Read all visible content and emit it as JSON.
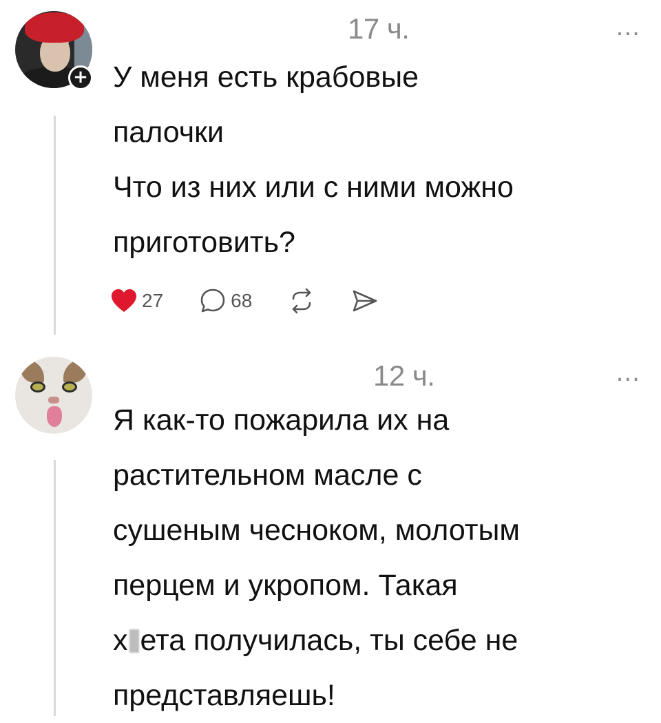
{
  "posts": [
    {
      "time": "17 ч.",
      "more": "...",
      "follow_badge": "+",
      "lines": [
        "У меня есть крабовые",
        "палочки",
        "Что из них или с ними можно",
        "приготовить?"
      ],
      "likes": "27",
      "comments": "68",
      "liked": true,
      "colors": {
        "heart": "#e0182d"
      }
    },
    {
      "time": "12 ч.",
      "more": "...",
      "lines": [
        "Я как-то пожарила их на",
        "растительном масле с",
        "сушеным чесноком, молотым",
        "перцем и укропом. Такая"
      ],
      "censored_line_start": "х",
      "censored_line_end": "ета получилась, ты себе не",
      "last_line": "представляешь!"
    }
  ],
  "icons": {
    "heart": "heart-icon",
    "comment": "comment-icon",
    "repost": "repost-icon",
    "share": "send-icon",
    "more": "more-icon"
  }
}
